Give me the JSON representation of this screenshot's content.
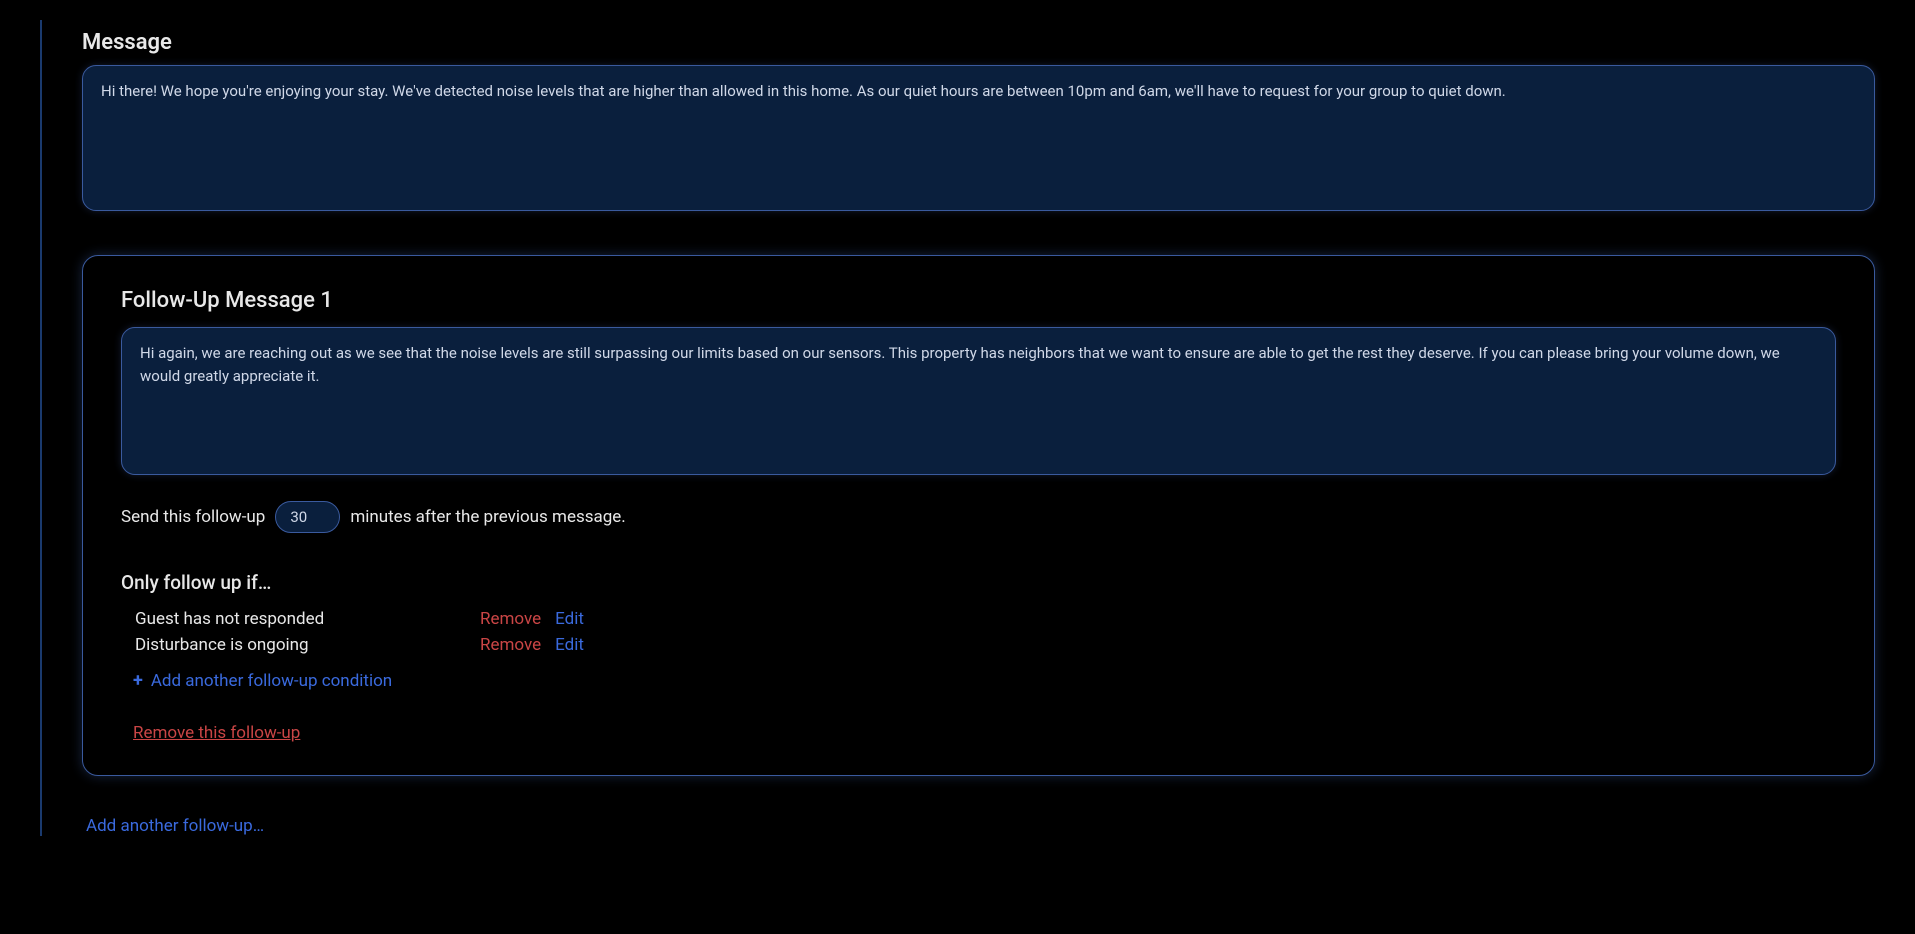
{
  "message": {
    "label": "Message",
    "content": "Hi there! We hope you're enjoying your stay. We've detected noise levels that are higher than allowed in this home. As our quiet hours are between 10pm and 6am, we'll have to request for your group to quiet down."
  },
  "followup": {
    "label": "Follow-Up Message 1",
    "content": "Hi again, we are reaching out as we see that the noise levels are still surpassing our limits based on our sensors. This property has neighbors that we want to ensure are able to get the rest they deserve. If you can please bring your volume down, we would greatly appreciate it.",
    "timing": {
      "prefix": "Send this follow-up",
      "value": "30",
      "suffix": "minutes after the previous message."
    },
    "conditions": {
      "label": "Only follow up if…",
      "items": [
        {
          "text": "Guest has not responded",
          "remove_label": "Remove",
          "edit_label": "Edit"
        },
        {
          "text": "Disturbance is ongoing",
          "remove_label": "Remove",
          "edit_label": "Edit"
        }
      ],
      "add_label": "Add another follow-up condition"
    },
    "remove_label": "Remove this follow-up"
  },
  "add_followup_label": "Add another follow-up…"
}
